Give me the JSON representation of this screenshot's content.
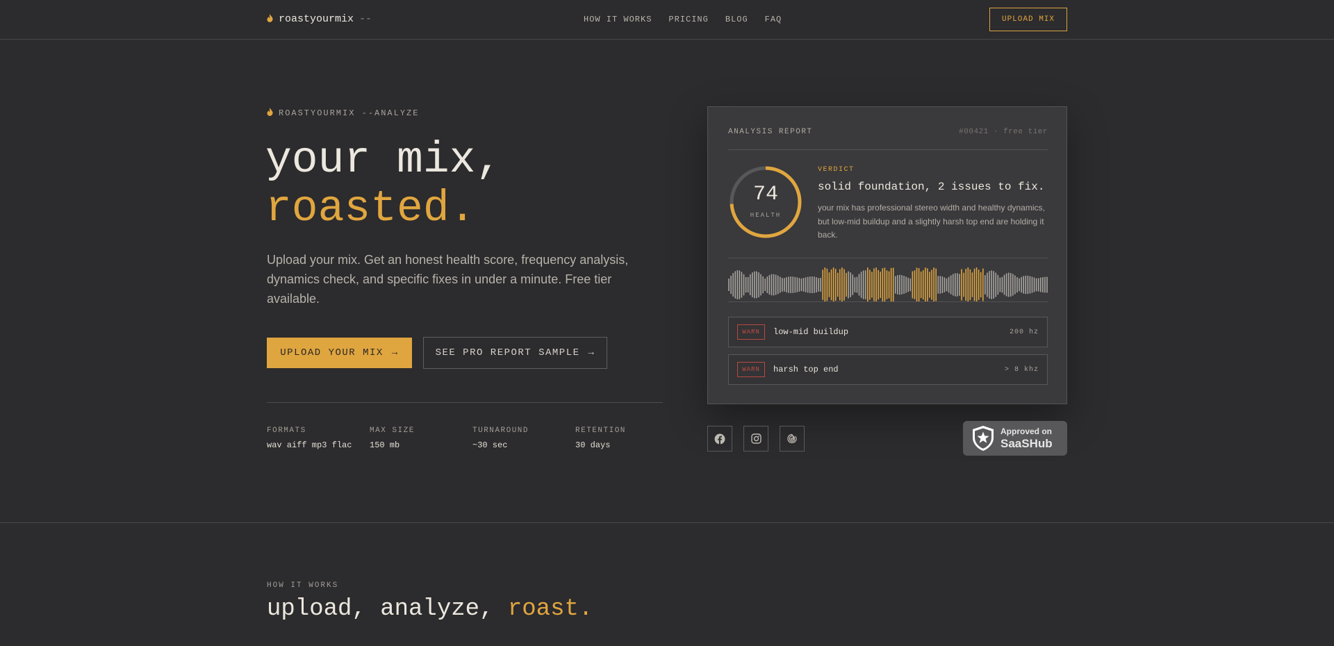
{
  "nav": {
    "logo_text": "roastyourmix",
    "logo_cursor": "--",
    "links": [
      "HOW IT WORKS",
      "PRICING",
      "BLOG",
      "FAQ"
    ],
    "cta": "UPLOAD MIX"
  },
  "hero": {
    "eyebrow": "ROASTYOURMIX --ANALYZE",
    "title_line1": "your mix,",
    "title_line2": "roasted.",
    "lede": "Upload your mix. Get an honest health score, frequency analysis, dynamics check, and specific fixes in under a minute. Free tier available.",
    "primary_cta": "UPLOAD YOUR MIX",
    "secondary_cta": "SEE PRO REPORT SAMPLE",
    "arrow": "→",
    "specs": [
      {
        "label": "FORMATS",
        "value": "wav aiff mp3 flac"
      },
      {
        "label": "MAX SIZE",
        "value": "150 mb"
      },
      {
        "label": "TURNAROUND",
        "value": "~30 sec"
      },
      {
        "label": "RETENTION",
        "value": "30 days"
      }
    ]
  },
  "report": {
    "title": "ANALYSIS REPORT",
    "meta": "#00421 · free tier",
    "score": "74",
    "score_fraction": 0.74,
    "score_label": "HEALTH",
    "verdict_label": "VERDICT",
    "verdict_title": "solid foundation, 2 issues to fix.",
    "verdict_body": "your mix has professional stereo width and healthy dynamics, but low-mid buildup and a slightly harsh top end are holding it back.",
    "issues": [
      {
        "badge": "WARN",
        "name": "low-mid buildup",
        "value": "200 hz"
      },
      {
        "badge": "WARN",
        "name": "harsh top end",
        "value": "> 8 khz"
      }
    ]
  },
  "social": {
    "icons": [
      "facebook-icon",
      "instagram-icon",
      "threads-icon"
    ]
  },
  "saashub": {
    "line1": "Approved on",
    "line2": "SaaSHub"
  },
  "how": {
    "eyebrow": "HOW IT WORKS",
    "title_main": "upload, analyze,",
    "title_accent": "roast."
  },
  "colors": {
    "accent": "#e0a63f",
    "background": "#2c2b2d",
    "card": "#3a393b",
    "warn": "#c14d44"
  }
}
